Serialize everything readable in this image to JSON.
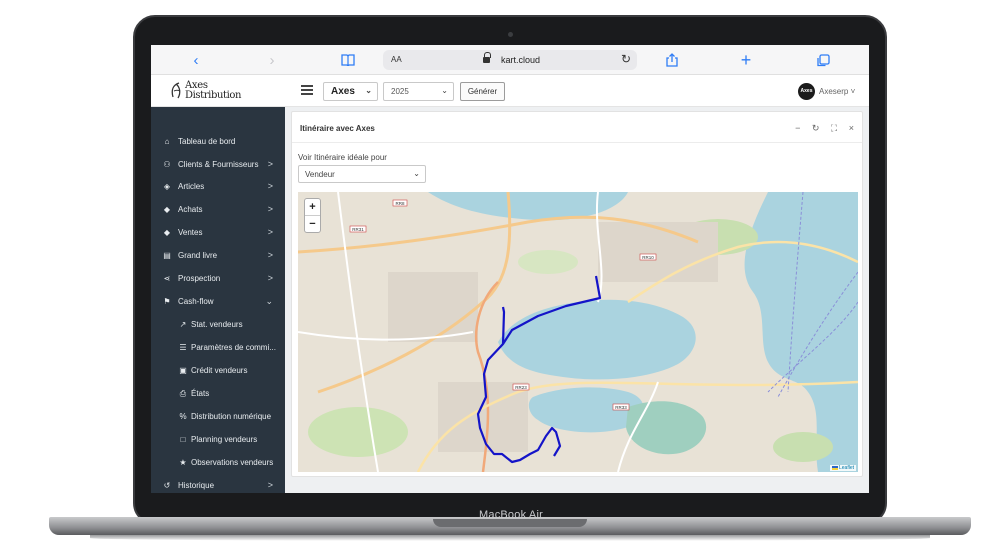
{
  "device": {
    "label": "MacBook Air"
  },
  "browser": {
    "reader_label": "AA",
    "url": "kart.cloud",
    "icons": [
      "back-icon",
      "forward-icon",
      "bookmarks-icon",
      "lock-icon",
      "reload-icon",
      "share-icon",
      "new-tab-icon",
      "tabs-icon"
    ]
  },
  "header": {
    "logo_line1": "Axes",
    "logo_line2": "Distribution",
    "company": "Axes",
    "year": "2025",
    "generate_label": "Générer",
    "avatar_text": "Axes",
    "user_name": "Axeserp"
  },
  "sidebar": {
    "items": [
      {
        "label": "Tableau de bord",
        "icon": "home-icon",
        "glyph": "⌂",
        "chevron": ""
      },
      {
        "label": "Clients & Fournisseurs",
        "icon": "user-icon",
        "glyph": "⚇",
        "chevron": ">"
      },
      {
        "label": "Articles",
        "icon": "box-icon",
        "glyph": "◈",
        "chevron": ">"
      },
      {
        "label": "Achats",
        "icon": "tag-icon",
        "glyph": "◆",
        "chevron": ">"
      },
      {
        "label": "Ventes",
        "icon": "tag-icon",
        "glyph": "◆",
        "chevron": ">"
      },
      {
        "label": "Grand livre",
        "icon": "book-icon",
        "glyph": "▤",
        "chevron": ">"
      },
      {
        "label": "Prospection",
        "icon": "share-icon",
        "glyph": "⋖",
        "chevron": ">"
      },
      {
        "label": "Cash-flow",
        "icon": "flag-icon",
        "glyph": "⚑",
        "chevron": "⌄"
      }
    ],
    "subitems": [
      {
        "label": "Stat. vendeurs",
        "icon": "chart-icon",
        "glyph": "↗"
      },
      {
        "label": "Paramètres de commi...",
        "icon": "sliders-icon",
        "glyph": "☰"
      },
      {
        "label": "Crédit vendeurs",
        "icon": "money-icon",
        "glyph": "▣"
      },
      {
        "label": "États",
        "icon": "printer-icon",
        "glyph": "⎙"
      },
      {
        "label": "Distribution numérique",
        "icon": "percent-icon",
        "glyph": "%"
      },
      {
        "label": "Planning vendeurs",
        "icon": "calendar-icon",
        "glyph": "□"
      },
      {
        "label": "Observations vendeurs",
        "icon": "star-icon",
        "glyph": "★"
      }
    ],
    "footer_item": {
      "label": "Historique",
      "icon": "history-icon",
      "glyph": "↺",
      "chevron": ">"
    }
  },
  "card": {
    "title": "Itinéraire avec Axes",
    "tools": {
      "minimize": "−",
      "refresh": "↻",
      "expand": "⛶",
      "close": "×"
    },
    "field_label": "Voir Itinéraire idéale pour",
    "role_select": "Vendeur"
  },
  "map": {
    "zoom_in": "+",
    "zoom_out": "−",
    "attribution": "Leaflet",
    "route_color": "#1414c8",
    "road_labels": [
      "RR8",
      "RR31",
      "RR10",
      "RR23",
      "RR33"
    ]
  }
}
